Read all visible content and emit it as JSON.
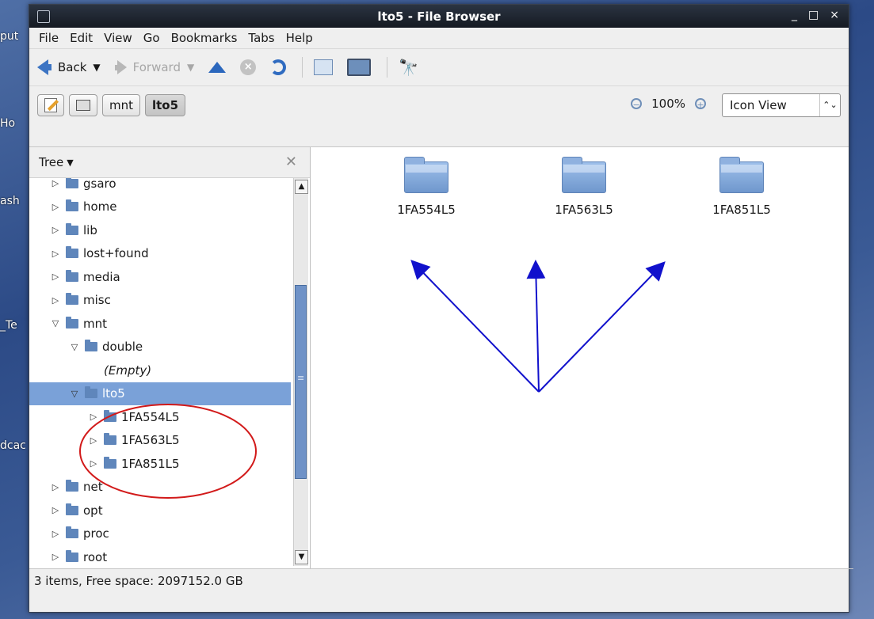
{
  "desktop": {
    "labels": [
      "put",
      "Ho",
      "ash",
      "_Te",
      "dcac"
    ]
  },
  "window": {
    "title": "lto5 - File Browser",
    "controls": [
      "_",
      "□",
      "×"
    ]
  },
  "menu": [
    "File",
    "Edit",
    "View",
    "Go",
    "Bookmarks",
    "Tabs",
    "Help"
  ],
  "toolbar": {
    "back": "Back",
    "forward": "Forward"
  },
  "location": {
    "path": [
      "mnt",
      "lto5"
    ],
    "zoom": "100%",
    "view": "Icon View"
  },
  "sidebar": {
    "title": "Tree",
    "items": [
      {
        "label": "gsaro",
        "level": 1,
        "expander": "▷"
      },
      {
        "label": "home",
        "level": 1,
        "expander": "▷"
      },
      {
        "label": "lib",
        "level": 1,
        "expander": "▷"
      },
      {
        "label": "lost+found",
        "level": 1,
        "expander": "▷"
      },
      {
        "label": "media",
        "level": 1,
        "expander": "▷"
      },
      {
        "label": "misc",
        "level": 1,
        "expander": "▷"
      },
      {
        "label": "mnt",
        "level": 1,
        "expander": "▽"
      },
      {
        "label": "double",
        "level": 2,
        "expander": "▽"
      },
      {
        "label": "(Empty)",
        "level": 3,
        "expander": ""
      },
      {
        "label": "lto5",
        "level": 2,
        "expander": "▽",
        "selected": true
      },
      {
        "label": "1FA554L5",
        "level": 3,
        "expander": "▷"
      },
      {
        "label": "1FA563L5",
        "level": 3,
        "expander": "▷"
      },
      {
        "label": "1FA851L5",
        "level": 3,
        "expander": "▷"
      },
      {
        "label": "net",
        "level": 1,
        "expander": "▷"
      },
      {
        "label": "opt",
        "level": 1,
        "expander": "▷"
      },
      {
        "label": "proc",
        "level": 1,
        "expander": "▷"
      },
      {
        "label": "root",
        "level": 1,
        "expander": "▷"
      }
    ]
  },
  "files": [
    "1FA554L5",
    "1FA563L5",
    "1FA851L5"
  ],
  "status": "3 items, Free space: 2097152.0 GB",
  "annotation": {
    "arrow_color": "#1111cc",
    "circle_color": "#d21a1a"
  }
}
